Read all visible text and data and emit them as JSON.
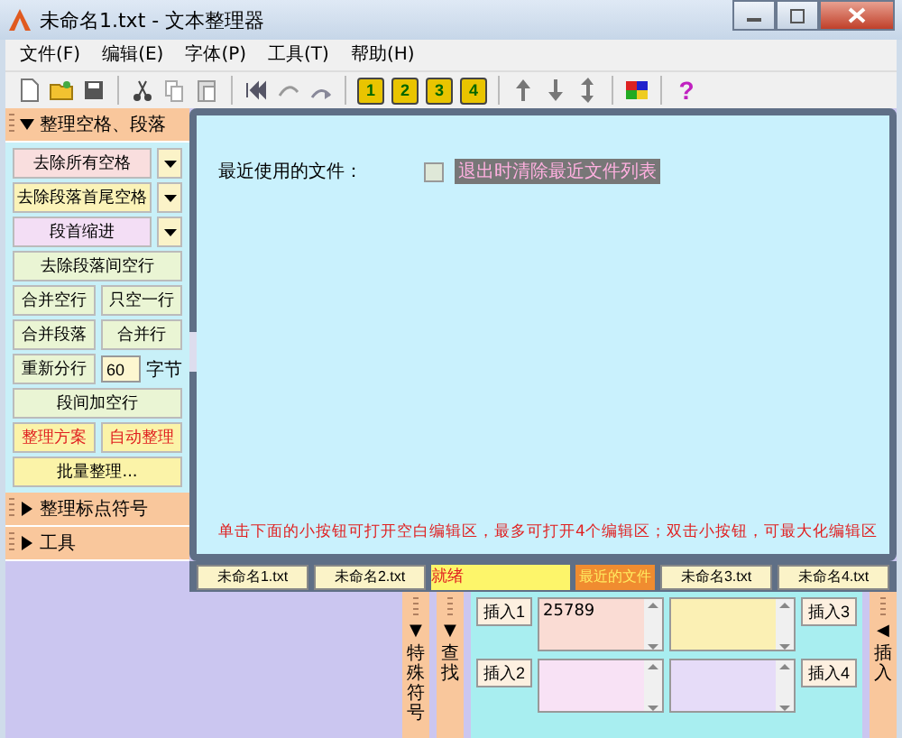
{
  "window": {
    "title": "未命名1.txt - 文本整理器"
  },
  "menu": [
    "文件(F)",
    "编辑(E)",
    "字体(P)",
    "工具(T)",
    "帮助(H)"
  ],
  "toolbar": [
    [
      {
        "kind": "new"
      },
      {
        "kind": "open"
      },
      {
        "kind": "save"
      }
    ],
    [
      {
        "kind": "cut"
      },
      {
        "kind": "copy"
      },
      {
        "kind": "paste"
      }
    ],
    [
      {
        "kind": "first"
      },
      {
        "kind": "undo"
      },
      {
        "kind": "redo"
      }
    ],
    [
      {
        "kind": "number",
        "label": "1"
      },
      {
        "kind": "number",
        "label": "2"
      },
      {
        "kind": "number",
        "label": "3"
      },
      {
        "kind": "number",
        "label": "4"
      }
    ],
    [
      {
        "kind": "up"
      },
      {
        "kind": "down"
      },
      {
        "kind": "updown"
      }
    ],
    [
      {
        "kind": "palette"
      }
    ],
    [
      {
        "kind": "help",
        "label": "?"
      }
    ]
  ],
  "sidebar": {
    "sections": [
      {
        "title": "整理空格、段落",
        "expanded": true,
        "rows": [
          [
            {
              "kind": "dropdown",
              "label": "去除所有空格",
              "color": "#f9dede"
            }
          ],
          [
            {
              "kind": "dropdown",
              "label": "去除段落首尾空格",
              "color": "#fbf3b8"
            }
          ],
          [
            {
              "kind": "dropdown",
              "label": "段首缩进",
              "color": "#f3def5"
            }
          ],
          [
            {
              "kind": "button",
              "label": "去除段落间空行",
              "color": "#eaf5d4"
            }
          ],
          [
            {
              "kind": "button",
              "label": "合并空行",
              "color": "#eaf5d4"
            },
            {
              "kind": "button",
              "label": "只空一行",
              "color": "#eaf5d4"
            }
          ],
          [
            {
              "kind": "button",
              "label": "合并段落",
              "color": "#eaf5d4"
            },
            {
              "kind": "button",
              "label": "合并行",
              "color": "#eaf5d4"
            }
          ],
          [
            {
              "kind": "button",
              "label": "重新分行",
              "color": "#eaf5d4"
            },
            {
              "kind": "input",
              "value": "60"
            },
            {
              "kind": "unit",
              "label": "字节"
            }
          ],
          [
            {
              "kind": "button",
              "label": "段间加空行",
              "color": "#eaf5d4"
            }
          ],
          [
            {
              "kind": "button",
              "label": "整理方案",
              "color": "#fbf3a8",
              "emphasis": true
            },
            {
              "kind": "button",
              "label": "自动整理",
              "color": "#fbf3a8",
              "emphasis": true
            }
          ],
          [
            {
              "kind": "button",
              "label": "批量整理...",
              "color": "#fbf3a8"
            }
          ]
        ]
      },
      {
        "title": "整理标点符号",
        "expanded": false
      },
      {
        "title": "工具",
        "expanded": false
      }
    ]
  },
  "main": {
    "recent_label": "最近使用的文件：",
    "clear_recent": {
      "label": "退出时清除最近文件列表",
      "checked": false
    },
    "hint": "单击下面的小按钮可打开空白编辑区，最多可打开4个编辑区；双击小按钮，可最大化编辑区"
  },
  "tabs": [
    {
      "kind": "tab",
      "label": "未命名1.txt"
    },
    {
      "kind": "tab",
      "label": "未命名2.txt"
    },
    {
      "kind": "status",
      "label": "就绪"
    },
    {
      "kind": "recent",
      "label": "最近的文件"
    },
    {
      "kind": "tab",
      "label": "未命名3.txt"
    },
    {
      "kind": "tab",
      "label": "未命名4.txt"
    }
  ],
  "bottom": {
    "panels": [
      {
        "label": "特殊符号",
        "arrow": "▼"
      },
      {
        "label": "查找",
        "arrow": "▼"
      }
    ],
    "inserts": [
      {
        "button": "插入1",
        "value": "25789",
        "color": "#fadcd4"
      },
      {
        "button": "插入3",
        "color": "#fbf0b4"
      },
      {
        "button": "插入2",
        "color": "#f8e2f5"
      },
      {
        "button": "插入4",
        "color": "#e6dcf8"
      }
    ],
    "right_panel": {
      "label": "插入",
      "arrow": "◀"
    }
  }
}
